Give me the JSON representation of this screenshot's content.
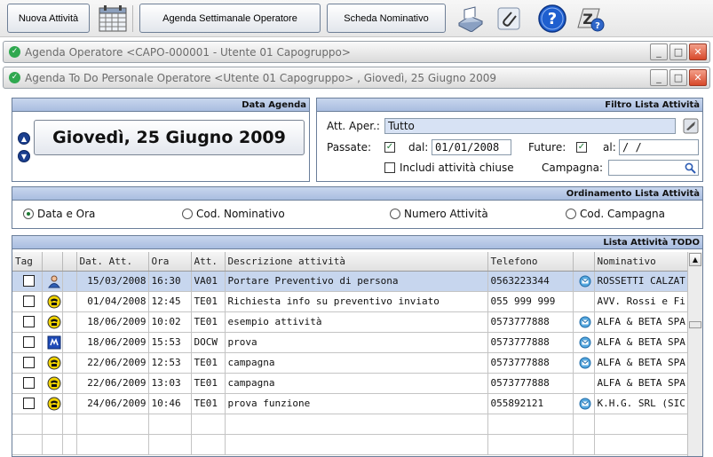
{
  "toolbar": {
    "new_activity": "Nuova Attività",
    "calendar_icon": "calendar-icon",
    "weekly_agenda": "Agenda Settimanale Operatore",
    "nominative_card": "Scheda Nominativo",
    "icons": [
      "print-icon",
      "attachment-icon",
      "help-icon",
      "info-icon"
    ]
  },
  "windows": {
    "outer_title": "Agenda Operatore <CAPO-000001 - Utente 01 Capogruppo>",
    "inner_title": "Agenda To Do Personale Operatore <Utente 01 Capogruppo> , Giovedì, 25 Giugno 2009"
  },
  "agenda": {
    "header": "Data Agenda",
    "date": "Giovedì, 25 Giugno 2009"
  },
  "filter": {
    "header": "Filtro Lista Attività",
    "att_aper_label": "Att. Aper.:",
    "att_aper_value": "Tutto",
    "past_label": "Passate:",
    "from_label": "dal:",
    "from_value": "01/01/2008",
    "future_label": "Future:",
    "to_label": "al:",
    "to_value": " /  /",
    "include_closed_label": "Includi attività chiuse",
    "campaign_label": "Campagna:",
    "campaign_value": ""
  },
  "ordering": {
    "header": "Ordinamento Lista Attività",
    "options": [
      "Data e Ora",
      "Cod. Nominativo",
      "Numero Attività",
      "Cod. Campagna"
    ],
    "selected": "Data e Ora"
  },
  "list": {
    "header": "Lista Attività TODO",
    "columns": [
      "Tag",
      "",
      "",
      "Dat. Att.",
      "Ora",
      "Att.",
      "Descrizione attività",
      "Telefono",
      "",
      "Nominativo"
    ],
    "rows": [
      {
        "icon": "person-icon",
        "date": "15/03/2008",
        "time": "16:30",
        "att": "VA01",
        "desc": "Portare Preventivo di persona",
        "phone": "0563223344",
        "mail": true,
        "name": "ROSSETTI CALZAT"
      },
      {
        "icon": "phone-icon",
        "date": "01/04/2008",
        "time": "12:45",
        "att": "TE01",
        "desc": "Richiesta info su preventivo inviato",
        "phone": "055 999 999",
        "mail": false,
        "name": "AVV. Rossi e Fi"
      },
      {
        "icon": "phone-icon",
        "date": "18/06/2009",
        "time": "10:02",
        "att": "TE01",
        "desc": "esempio attività",
        "phone": "0573777888",
        "mail": true,
        "name": "ALFA & BETA SPA"
      },
      {
        "icon": "document-icon",
        "date": "18/06/2009",
        "time": "15:53",
        "att": "DOCW",
        "desc": "prova",
        "phone": "0573777888",
        "mail": true,
        "name": "ALFA & BETA SPA"
      },
      {
        "icon": "phone-icon",
        "date": "22/06/2009",
        "time": "12:53",
        "att": "TE01",
        "desc": "campagna",
        "phone": "0573777888",
        "mail": true,
        "name": "ALFA & BETA SPA"
      },
      {
        "icon": "phone-icon",
        "date": "22/06/2009",
        "time": "13:03",
        "att": "TE01",
        "desc": "campagna",
        "phone": "0573777888",
        "mail": false,
        "name": "ALFA & BETA SPA"
      },
      {
        "icon": "phone-icon",
        "date": "24/06/2009",
        "time": "10:46",
        "att": "TE01",
        "desc": "prova funzione",
        "phone": "055892121",
        "mail": true,
        "name": "K.H.G. SRL (SIC"
      }
    ]
  }
}
